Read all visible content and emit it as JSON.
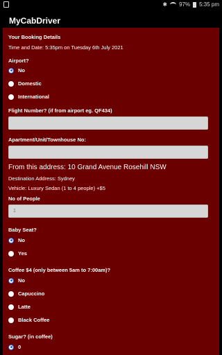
{
  "status_bar": {
    "battery": "97%",
    "time": "5:35 pm"
  },
  "app": {
    "title": "MyCabDriver"
  },
  "booking": {
    "heading": "Your Booking Details",
    "time_and_date": "Time and Date: 5:35pm on Tuesday 6th July 2021",
    "airport": {
      "question": "Airport?",
      "options": [
        "No",
        "Domestic",
        "International"
      ]
    },
    "flight_number": {
      "label": "Flight Number? (if from airport eg. QF434)",
      "value": ""
    },
    "apartment": {
      "label": "Apartment/Unit/Townhouse No:",
      "value": ""
    },
    "from_address": "From this address: 10 Grand Avenue Rosehill NSW",
    "destination": "Destination Address: Sydney",
    "vehicle": "Vehicle: Luxury Sedan (1 to 4 people) +$5",
    "people": {
      "label": "No of People",
      "value": "1"
    },
    "baby_seat": {
      "question": "Baby Seat?",
      "options": [
        "No",
        "Yes"
      ]
    },
    "coffee": {
      "question": "Coffee $4 (only between 5am to 7:00am)?",
      "options": [
        "No",
        "Capuccino",
        "Latte",
        "Black Coffee"
      ]
    },
    "sugar": {
      "question": "Sugar? (in coffee)",
      "options": [
        "0"
      ]
    }
  }
}
